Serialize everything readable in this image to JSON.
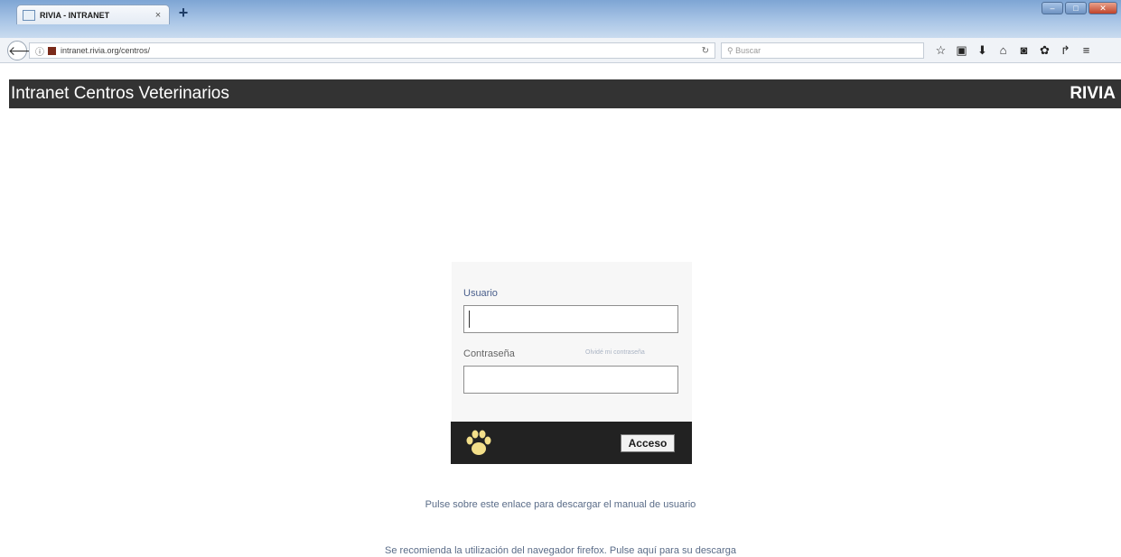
{
  "browser": {
    "tab_title": "RIVIA - INTRANET",
    "tab_close": "×",
    "new_tab": "+",
    "url": "intranet.rivia.org/centros/",
    "search_placeholder": "Buscar",
    "icons": [
      "star-icon",
      "clipboard-icon",
      "download-icon",
      "home-icon",
      "pocket-icon",
      "extension-icon",
      "share-icon",
      "menu-icon"
    ]
  },
  "header": {
    "title": "Intranet Centros Veterinarios",
    "brand": "RIVIA",
    "background": "#333333"
  },
  "login": {
    "username_label": "Usuario",
    "username_value": "",
    "password_label": "Contraseña",
    "forgot_password": "Olvidé mi contraseña",
    "password_value": "",
    "submit_label": "Acceso",
    "logo_icon": "paw-icon"
  },
  "footer": {
    "manual_link": "Pulse sobre este enlace para descargar el manual de usuario",
    "browser_note": "Se recomienda la utilización del navegador firefox. Pulse aquí para su descarga"
  }
}
